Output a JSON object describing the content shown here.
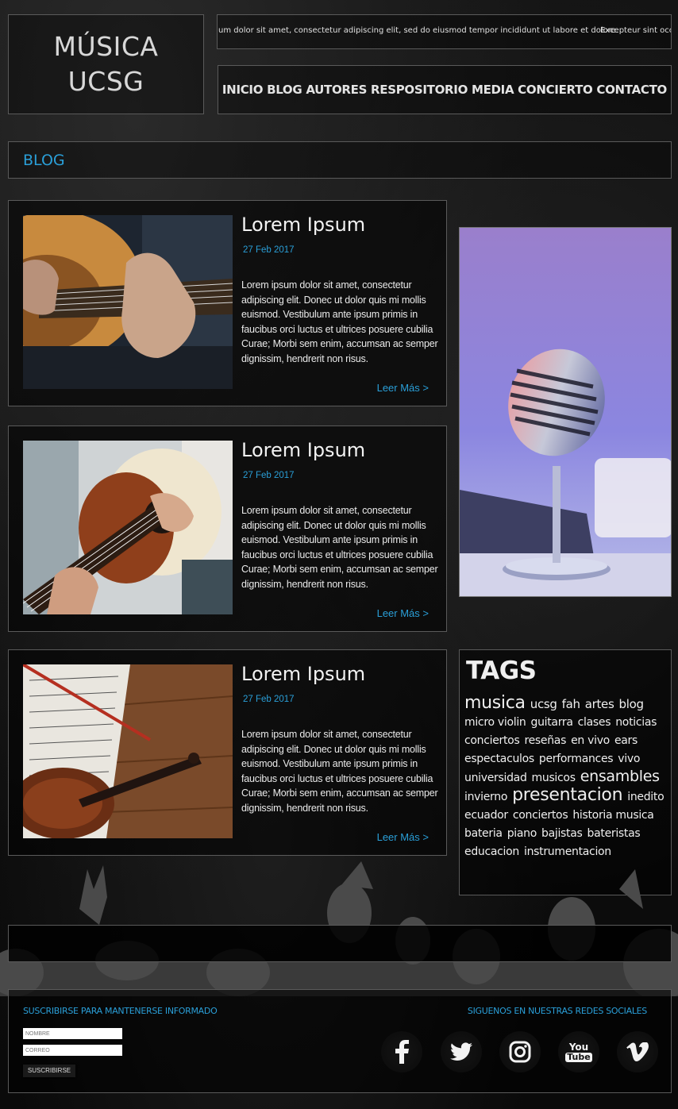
{
  "logo": {
    "line1": "MÚSICA",
    "line2": "UCSG"
  },
  "ticker": {
    "text1": "um dolor sit amet, consectetur adipiscing elit, sed do eiusmod tempor incididunt ut labore et dolore.",
    "text2": "Excepteur sint occaec"
  },
  "nav": {
    "items": [
      {
        "label": "INICIO"
      },
      {
        "label": "BLOG"
      },
      {
        "label": "AUTORES"
      },
      {
        "label": "RESPOSITORIO"
      },
      {
        "label": "MEDIA"
      },
      {
        "label": "CONCIERTO"
      },
      {
        "label": "CONTACTO"
      }
    ]
  },
  "page": {
    "title": "BLOG"
  },
  "posts": [
    {
      "title": "Lorem Ipsum",
      "date": "27 Feb 2017",
      "body": "Lorem ipsum dolor sit amet, consectetur adipiscing elit. Donec ut dolor quis mi mollis euismod. Vestibulum ante ipsum primis in faucibus orci luctus et ultrices posuere cubilia Curae; Morbi sem enim, accumsan ac semper dignissim, hendrerit non risus.",
      "more": "Leer Más >"
    },
    {
      "title": "Lorem Ipsum",
      "date": "27 Feb 2017",
      "body": "Lorem ipsum dolor sit amet, consectetur adipiscing elit. Donec ut dolor quis mi mollis euismod. Vestibulum ante ipsum primis in faucibus orci luctus et ultrices posuere cubilia Curae; Morbi sem enim, accumsan ac semper dignissim, hendrerit non risus.",
      "more": "Leer Más >"
    },
    {
      "title": "Lorem Ipsum",
      "date": "27 Feb 2017",
      "body": "Lorem ipsum dolor sit amet, consectetur adipiscing elit. Donec ut dolor quis mi mollis euismod. Vestibulum ante ipsum primis in faucibus orci luctus et ultrices posuere cubilia Curae; Morbi sem enim, accumsan ac semper dignissim, hendrerit non risus.",
      "more": "Leer Más >"
    }
  ],
  "tags": {
    "title": "TAGS",
    "items": [
      "musica",
      "ucsg",
      "fah",
      "artes",
      "blog",
      "micro violin",
      "guitarra",
      "clases",
      "noticias",
      "conciertos",
      "reseñas",
      "en vivo",
      "ears",
      "espectaculos",
      "performances",
      "vivo",
      "universidad",
      "musicos",
      "ensambles",
      "invierno",
      "presentacion",
      "inedito",
      "ecuador",
      "conciertos",
      "historia musica",
      "bateria",
      "piano",
      "bajistas",
      "bateristas",
      "educacion",
      "instrumentacion"
    ]
  },
  "footer": {
    "subscribe_label": "SUSCRIBIRSE PARA MANTENERSE INFORMADO",
    "name_placeholder": "NOMBRE",
    "email_placeholder": "CORREO",
    "subscribe_button": "SUSCRIBIRSE",
    "social_label": "SIGUENOS EN NUESTRAS REDES SOCIALES",
    "youtube_you": "You",
    "youtube_tube": "Tube"
  },
  "colors": {
    "accent": "#2a9fd8",
    "text": "#eaeaea",
    "border": "#5a5a5a"
  },
  "icons": [
    "facebook-icon",
    "twitter-icon",
    "instagram-icon",
    "youtube-icon",
    "vimeo-icon"
  ]
}
